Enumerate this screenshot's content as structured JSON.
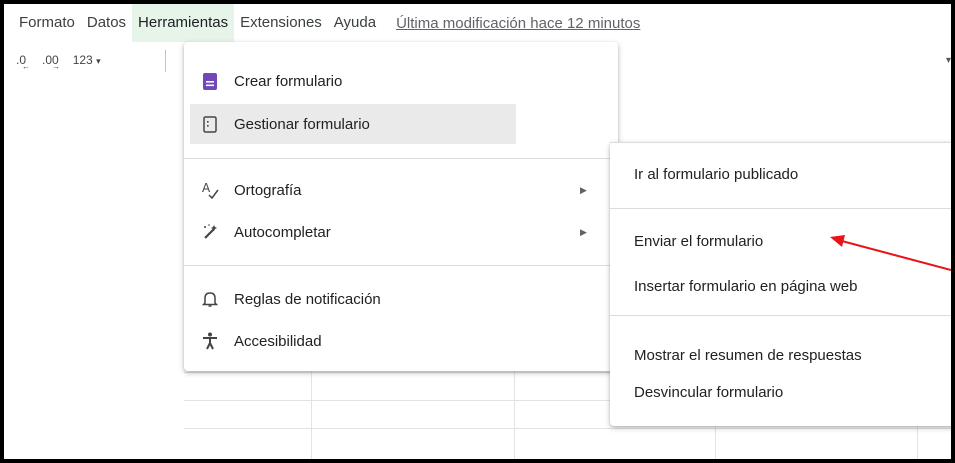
{
  "menubar": {
    "items": [
      "Formato",
      "Datos",
      "Herramientas",
      "Extensiones",
      "Ayuda"
    ],
    "active_index": 2,
    "last_modified": "Última modificación hace 12 minutos"
  },
  "toolbar": {
    "decrease_decimals": ".0",
    "increase_decimals": ".00",
    "number_format": "123"
  },
  "tools_menu": {
    "create_form": "Crear formulario",
    "manage_form": "Gestionar formulario",
    "spelling": "Ortografía",
    "autocomplete": "Autocompletar",
    "notification_rules": "Reglas de notificación",
    "accessibility": "Accesibilidad"
  },
  "form_submenu": {
    "go_to_published": "Ir al formulario publicado",
    "send_form": "Enviar el formulario",
    "embed_form": "Insertar formulario en página web",
    "show_summary": "Mostrar el resumen de respuestas",
    "unlink_form": "Desvincular formulario"
  },
  "colors": {
    "active_menu_bg": "#e6f4ea",
    "forms_purple": "#7248b9",
    "annotation_red": "#e8141b"
  }
}
